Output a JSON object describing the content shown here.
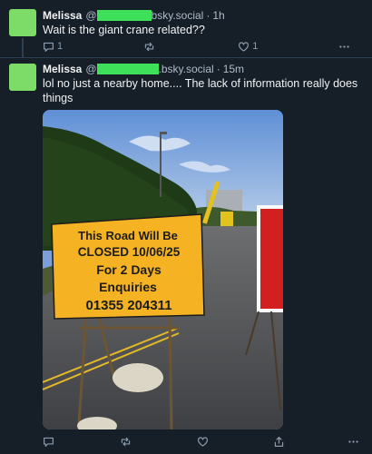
{
  "posts": [
    {
      "author": "Melissa",
      "handle_prefix": "@",
      "handle_suffix": "bsky.social",
      "separator": "·",
      "time": "1h",
      "text": "Wait is the giant crane related??",
      "actions": {
        "reply_count": "1",
        "repost_count": "",
        "like_count": "1"
      }
    },
    {
      "author": "Melissa",
      "handle_prefix": "@",
      "handle_suffix": ".bsky.social",
      "separator": "·",
      "time": "15m",
      "text": "lol no just a nearby home.... The lack of information really does things",
      "image": {
        "sign_line1": "This Road Will Be",
        "sign_line2": "CLOSED 10/06/25",
        "sign_line3": "For 2 Days",
        "sign_line4": "Enquiries",
        "sign_line5": "01355 204311"
      },
      "actions": {
        "reply_count": "",
        "repost_count": "",
        "like_count": ""
      }
    }
  ],
  "icons": [
    "reply-icon",
    "repost-icon",
    "like-icon",
    "more-icon",
    "share-icon"
  ],
  "colors": {
    "background": "#161e27",
    "avatar": "#7ddc68",
    "redaction": "#3ee05a",
    "sign": "#f5b324"
  }
}
